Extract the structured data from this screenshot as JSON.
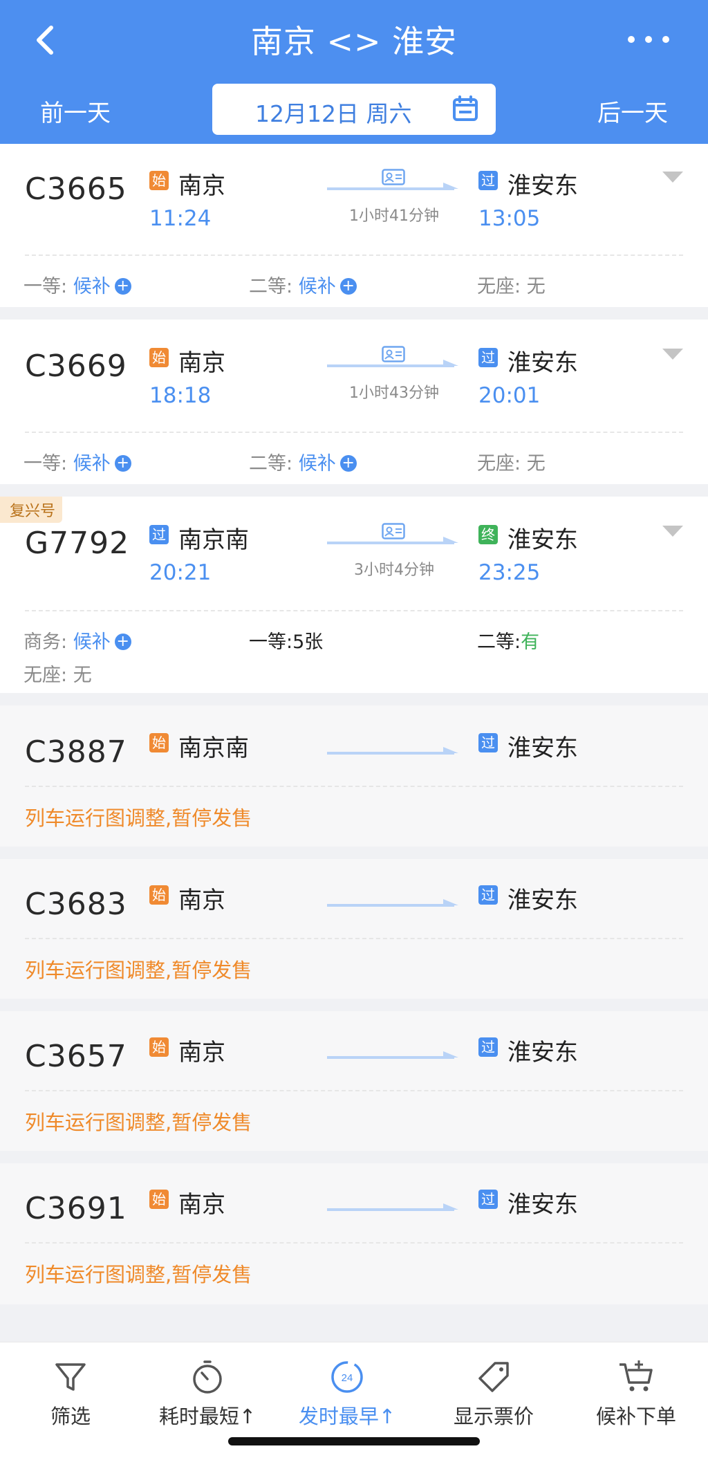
{
  "header": {
    "title": "南京 <> 淮安",
    "prev_day": "前一天",
    "next_day": "后一天",
    "date": "12月12日 周六",
    "accent": "#4d8ff0"
  },
  "trains": [
    {
      "no": "C3665",
      "from_badge": "始",
      "from": "南京",
      "dep": "11:24",
      "to_badge": "过",
      "to": "淮安东",
      "arr": "13:05",
      "duration": "1小时41分钟",
      "seats": [
        {
          "label": "一等:",
          "value": "候补"
        },
        {
          "label": "二等:",
          "value": "候补"
        },
        {
          "label": "无座:",
          "value": "无"
        }
      ]
    },
    {
      "no": "C3669",
      "from_badge": "始",
      "from": "南京",
      "dep": "18:18",
      "to_badge": "过",
      "to": "淮安东",
      "arr": "20:01",
      "duration": "1小时43分钟",
      "seats": [
        {
          "label": "一等:",
          "value": "候补"
        },
        {
          "label": "二等:",
          "value": "候补"
        },
        {
          "label": "无座:",
          "value": "无"
        }
      ]
    },
    {
      "tag": "复兴号",
      "no": "G7792",
      "from_badge": "过",
      "from": "南京南",
      "dep": "20:21",
      "to_badge": "终",
      "to": "淮安东",
      "arr": "23:25",
      "duration": "3小时4分钟",
      "seats": [
        {
          "label": "商务:",
          "value": "候补"
        },
        {
          "label": "一等:",
          "value": "5张"
        },
        {
          "label": "二等:",
          "value": "有"
        },
        {
          "label": "无座:",
          "value": "无"
        }
      ]
    },
    {
      "no": "C3887",
      "from_badge": "始",
      "from": "南京南",
      "to_badge": "过",
      "to": "淮安东",
      "notice": "列车运行图调整,暂停发售"
    },
    {
      "no": "C3683",
      "from_badge": "始",
      "from": "南京",
      "to_badge": "过",
      "to": "淮安东",
      "notice": "列车运行图调整,暂停发售"
    },
    {
      "no": "C3657",
      "from_badge": "始",
      "from": "南京",
      "to_badge": "过",
      "to": "淮安东",
      "notice": "列车运行图调整,暂停发售"
    },
    {
      "no": "C3691",
      "from_badge": "始",
      "from": "南京",
      "to_badge": "过",
      "to": "淮安东",
      "notice": "列车运行图调整,暂停发售"
    }
  ],
  "bottom_tabs": [
    {
      "label": "筛选",
      "icon": "filter-icon"
    },
    {
      "label": "耗时最短↑",
      "icon": "stopwatch-icon"
    },
    {
      "label": "发时最早↑",
      "icon": "clock-24-icon",
      "active": true
    },
    {
      "label": "显示票价",
      "icon": "price-tag-icon"
    },
    {
      "label": "候补下单",
      "icon": "cart-plus-icon"
    }
  ],
  "calendar_icon_text": "24"
}
